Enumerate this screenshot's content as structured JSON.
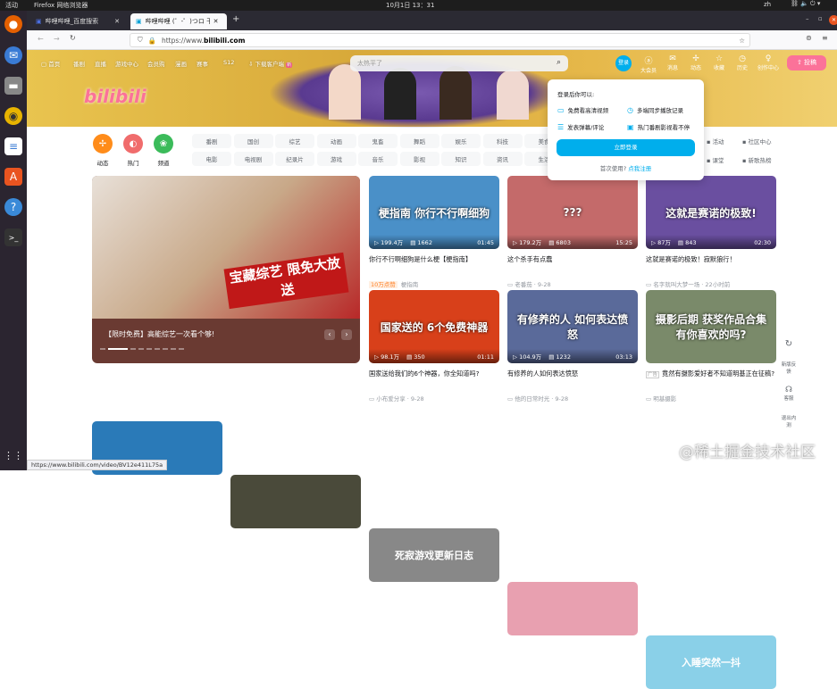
{
  "system": {
    "activities": "活动",
    "app_menu": "Firefox 网络浏览器",
    "clock": "10月1日 13：31",
    "lang": "zh"
  },
  "browser": {
    "tabs": [
      {
        "label": "哔哩哔哩_百度搜索"
      },
      {
        "label": "哔哩哔哩 (゜-゜)つロ 干杯"
      }
    ],
    "url_prefix": "https://www.",
    "url_domain": "bilibili.com",
    "status_url": "https://www.bilibili.com/video/BV12e411L75a"
  },
  "header": {
    "nav": [
      "首页",
      "番剧",
      "直播",
      "游戏中心",
      "会员购",
      "漫画",
      "赛事",
      "S12",
      "下载客户端"
    ],
    "search_placeholder": "太热平了",
    "login": "登录",
    "right": [
      "大会员",
      "消息",
      "动态",
      "收藏",
      "历史",
      "创作中心"
    ],
    "upload": "投稿",
    "logo": "bilibili"
  },
  "channels": {
    "main": [
      {
        "label": "动态",
        "color": "#ff8c1a"
      },
      {
        "label": "热门",
        "color": "#f06c6c"
      },
      {
        "label": "频道",
        "color": "#3bbb5a"
      }
    ],
    "row1": [
      "番剧",
      "国创",
      "综艺",
      "动画",
      "鬼畜",
      "舞蹈",
      "娱乐",
      "科技",
      "美食"
    ],
    "row2": [
      "电影",
      "电视剧",
      "纪录片",
      "游戏",
      "音乐",
      "影视",
      "知识",
      "资讯",
      "生活"
    ],
    "extra": [
      "活动",
      "社区中心",
      "课堂",
      "新歌热榜"
    ]
  },
  "login_popup": {
    "title": "登录后你可以:",
    "benefits": [
      "免费看高清视频",
      "多端同步播放记录",
      "发表弹幕/评论",
      "热门番剧影视看不停"
    ],
    "button": "立即登录",
    "first_use": "首次使用?",
    "register": "点我注册"
  },
  "carousel": {
    "caption": "【限时免费】高能综艺一次看个够!",
    "thumb_text": "宝藏综艺 限免大放送",
    "slides": 9,
    "active": 1
  },
  "videos": [
    {
      "thumb": "梗指南 你行不行啊细狗",
      "views": "199.4万",
      "danmaku": "1662",
      "duration": "01:45",
      "title": "你行不行啊细狗是什么梗【梗指南】",
      "badge": "10万点赞",
      "author": "梗指南",
      "date": "",
      "color": "#4a90c8"
    },
    {
      "thumb": "???",
      "views": "179.2万",
      "danmaku": "6803",
      "duration": "15:25",
      "title": "这个杀手有点蠢",
      "author": "老番茄",
      "date": "9-28",
      "color": "#c46a6a"
    },
    {
      "thumb": "这就是赛诺的极致!",
      "views": "87万",
      "danmaku": "843",
      "duration": "02:30",
      "title": "这就是赛诺的极致！寂默狼行！",
      "author": "名字就叫大梦一场",
      "date": "22小时前",
      "color": "#6a4fa0"
    },
    {
      "thumb": "国家送的 6个免费神器",
      "views": "98.1万",
      "danmaku": "350",
      "duration": "01:11",
      "title": "国家送给我们的6个神器，你全知道吗?",
      "author": "小布爱分享",
      "date": "9-28",
      "color": "#d8401a"
    },
    {
      "thumb": "有修养的人 如何表达愤怒",
      "views": "104.9万",
      "danmaku": "1232",
      "duration": "03:13",
      "title": "有修养的人如何表达愤怒",
      "author": "他的日常时光",
      "date": "9-28",
      "color": "#5a6a9a"
    },
    {
      "thumb": "摄影后期 获奖作品合集 有你喜欢的吗?",
      "views": "",
      "danmaku": "",
      "duration": "",
      "title": "竟然有摄影爱好者不知道明基正在征稿?",
      "ad": "广告",
      "author": "明基摄影",
      "date": "",
      "color": "#7a8a6a"
    }
  ],
  "bottom_row": [
    {
      "thumb": "",
      "color": "#2a7ab8"
    },
    {
      "thumb": "",
      "color": "#4a4a3a"
    },
    {
      "thumb": "死寂游戏更新日志",
      "color": "#888"
    },
    {
      "thumb": "",
      "color": "#e8a0b0"
    },
    {
      "thumb": "入睡突然一抖",
      "color": "#8ad0e8"
    }
  ],
  "side_buttons": [
    "新版反馈",
    "客服",
    "退出内测"
  ],
  "watermark": "@稀土掘金技术社区"
}
